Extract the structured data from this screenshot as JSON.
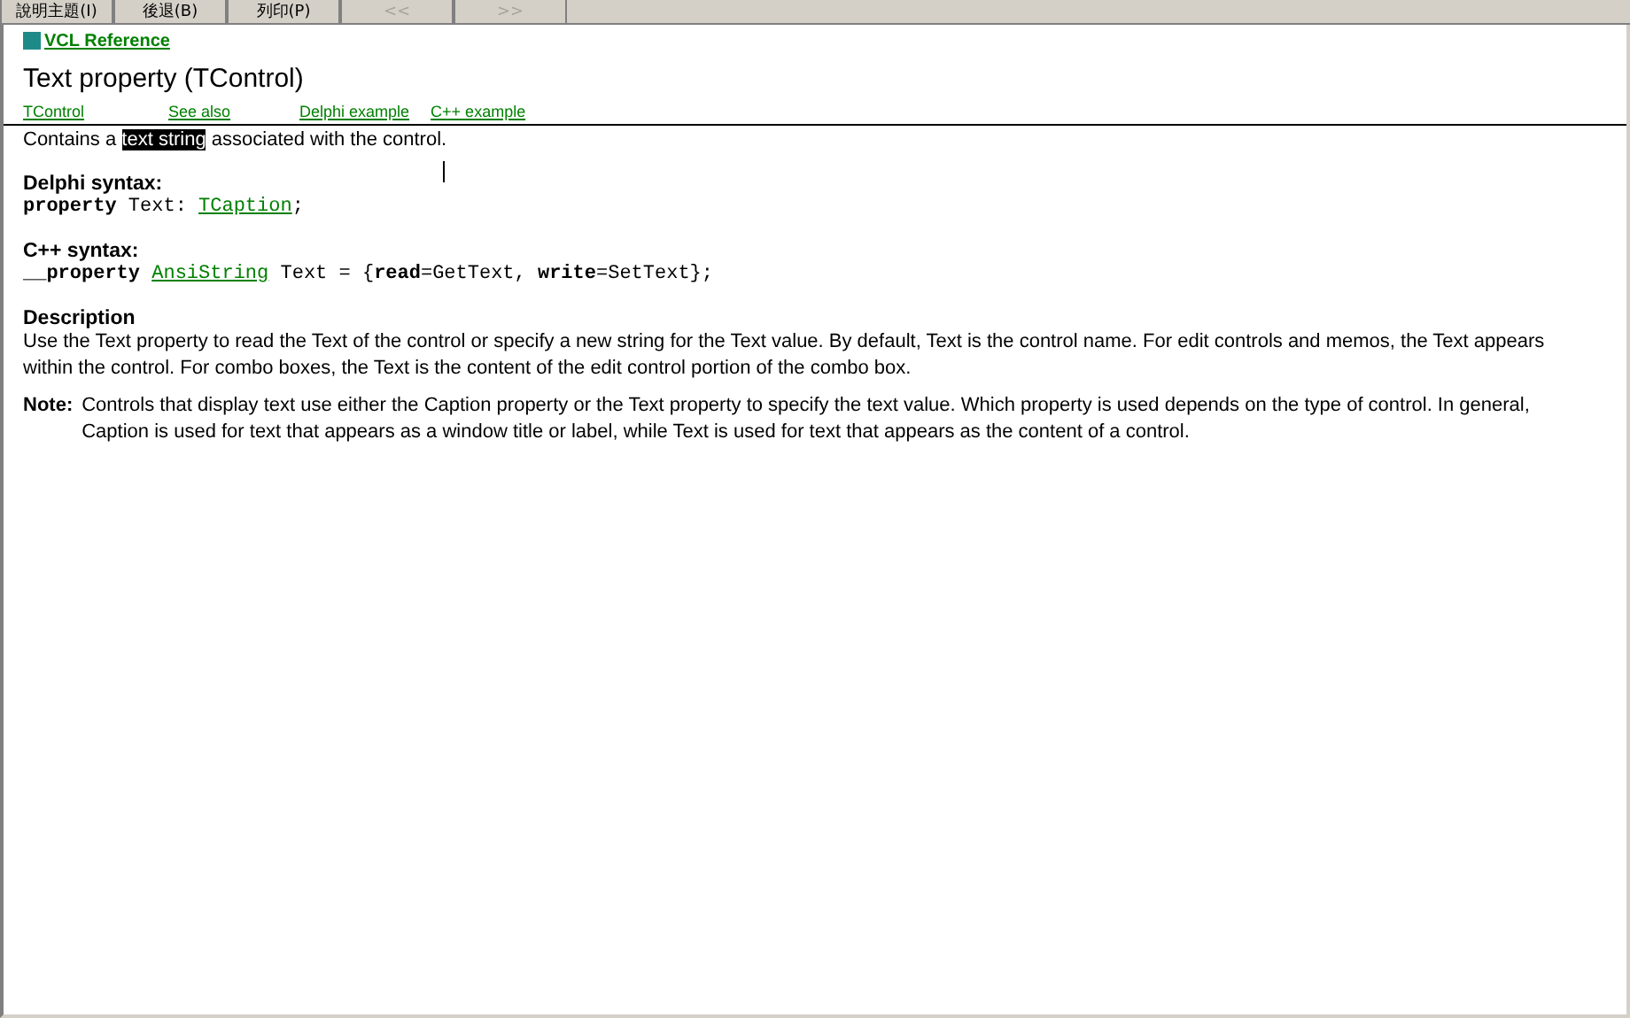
{
  "toolbar": [
    {
      "label": "說明主題(I)",
      "disabled": false
    },
    {
      "label": "後退(B)",
      "disabled": false
    },
    {
      "label": "列印(P)",
      "disabled": false
    },
    {
      "label": "<<",
      "disabled": true
    },
    {
      "label": ">>",
      "disabled": true
    }
  ],
  "breadcrumb": "VCL Reference",
  "title": "Text property (TControl)",
  "links": [
    "TControl",
    "See also",
    "Delphi example",
    "C++ example"
  ],
  "intro": [
    {
      "kind": "plain",
      "text": "Contains a "
    },
    {
      "kind": "selected",
      "text": "text string"
    },
    {
      "kind": "plain",
      "text": " associated with the control."
    }
  ],
  "sections": [
    {
      "heading": "Delphi syntax:",
      "code": [
        {
          "kind": "keyword",
          "text": "property"
        },
        {
          "kind": "plain",
          "text": " Text: "
        },
        {
          "kind": "link",
          "text": "TCaption"
        },
        {
          "kind": "plain",
          "text": ";"
        }
      ]
    },
    {
      "heading": "C++ syntax:",
      "code": [
        {
          "kind": "keyword",
          "text": "__property "
        },
        {
          "kind": "link",
          "text": "AnsiString"
        },
        {
          "kind": "plain",
          "text": " Text = {"
        },
        {
          "kind": "keyword",
          "text": "read"
        },
        {
          "kind": "plain",
          "text": "=GetText, "
        },
        {
          "kind": "keyword",
          "text": "write"
        },
        {
          "kind": "plain",
          "text": "=SetText};"
        }
      ]
    }
  ],
  "description": {
    "heading": "Description",
    "text": "Use the Text property to read the Text of the control or specify a new string for the Text value. By default, Text is the control name. For edit controls and memos, the Text appears within the control. For combo boxes, the Text is the content of the edit control portion of the combo box."
  },
  "note": {
    "label": "Note:",
    "text": "Controls that display text use either the Caption property or the Text property to specify the text value. Which property is used depends on the type of control. In general, Caption is used for text that appears as a window title or label, while Text is used for text that appears as the content of a control."
  }
}
